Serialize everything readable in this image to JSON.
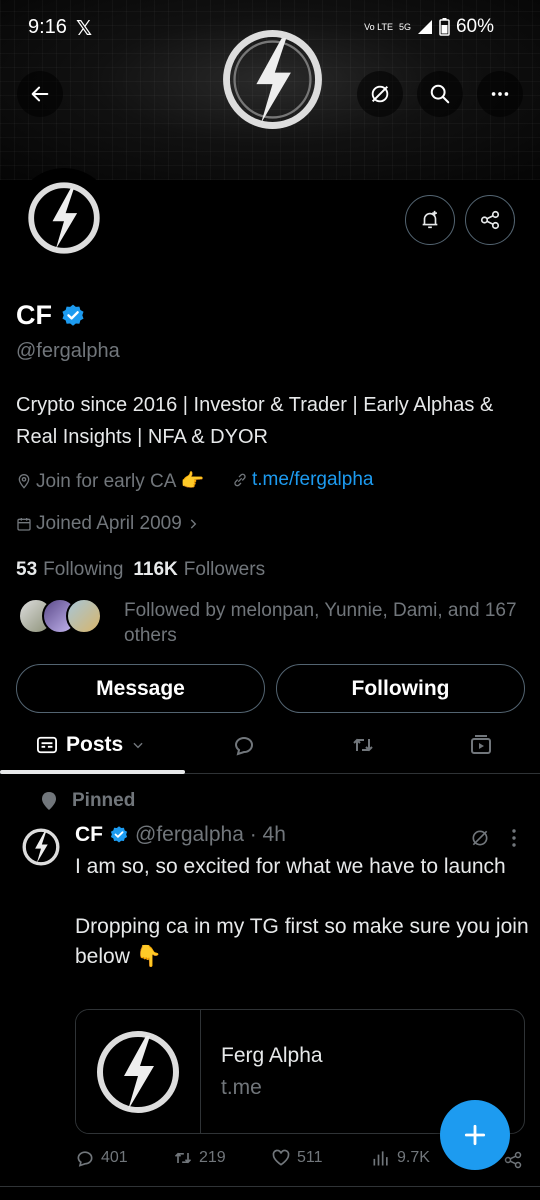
{
  "status_bar": {
    "time": "9:16",
    "x_label": "𝕏",
    "volte": "Vo LTE",
    "network": "5G",
    "battery": "60%"
  },
  "profile": {
    "name": "CF",
    "handle": "@fergalpha",
    "bio": "Crypto since 2016 | Investor & Trader | Early Alphas & Real Insights | NFA & DYOR",
    "location": "Join for early CA 👉",
    "website": "t.me/fergalpha",
    "joined": "Joined April 2009",
    "following_count": "53",
    "following_label": "Following",
    "followers_count": "116K",
    "followers_label": "Followers",
    "followed_by": "Followed by melonpan, Yunnie, Dami, and 167 others"
  },
  "buttons": {
    "message": "Message",
    "following": "Following"
  },
  "tabs": {
    "posts": "Posts"
  },
  "pinned_label": "Pinned",
  "post": {
    "name": "CF",
    "handle_time": "@fergalpha · 4h",
    "text": "I am so, so excited for what we have to launch\n\nDropping ca in my TG first so make sure you join below 👇",
    "card_title": "Ferg Alpha",
    "card_domain": "t.me",
    "replies": "401",
    "reposts": "219",
    "likes": "511",
    "views": "9.7K"
  },
  "colors": {
    "accent": "#1d9bf0",
    "background": "#000000",
    "muted": "#71767b"
  }
}
